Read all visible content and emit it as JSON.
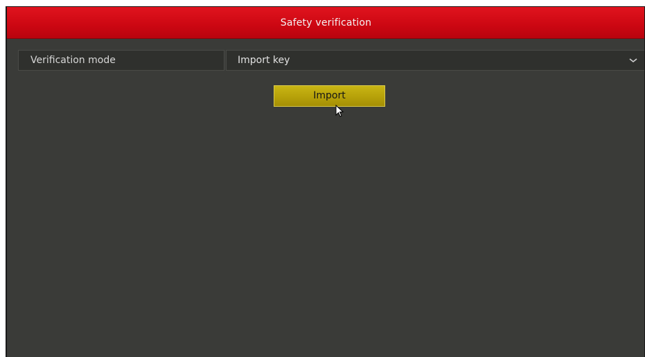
{
  "dialog": {
    "title": "Safety verification"
  },
  "verification": {
    "label": "Verification mode",
    "selected_value": "Import key"
  },
  "actions": {
    "import_label": "Import"
  },
  "icons": {
    "dropdown": "chevron-down-icon",
    "cursor": "mouse-pointer-icon"
  },
  "colors": {
    "titlebar": "#cc0712",
    "background": "#3a3b38",
    "button": "#b8a30a"
  }
}
